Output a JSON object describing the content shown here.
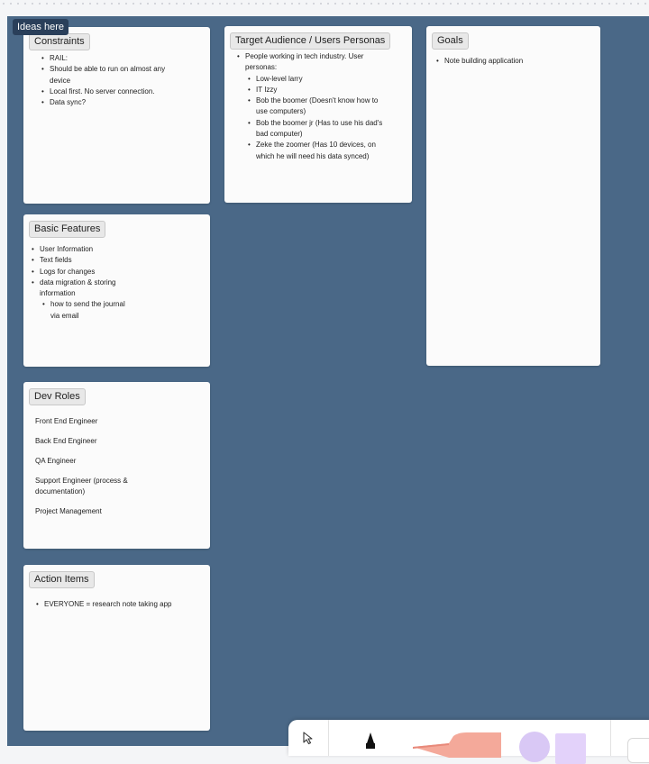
{
  "section": {
    "label": "Ideas here"
  },
  "cards": {
    "constraints": {
      "title": "Constraints",
      "items": [
        "RAIL:",
        "Should be able to run on almost any device",
        "Local first. No server connection.",
        "Data sync?"
      ]
    },
    "audience": {
      "title": "Target Audience / Users Personas",
      "intro": "People working in tech industry. User personas:",
      "personas": [
        "Low-level larry",
        "IT Izzy",
        "Bob the boomer (Doesn't know how to use computers)",
        "Bob the boomer jr (Has to use his dad's bad computer)",
        "Zeke the zoomer (Has 10 devices, on which he will need his data synced)"
      ]
    },
    "goals": {
      "title": "Goals",
      "items": [
        "Note building application"
      ]
    },
    "features": {
      "title": "Basic Features",
      "items": [
        "User Information",
        "Text fields",
        "Logs for changes",
        "data migration & storing information"
      ],
      "subitems": [
        "how to send the journal via email"
      ]
    },
    "roles": {
      "title": "Dev Roles",
      "items": [
        "Front End Engineer",
        "Back End Engineer",
        "QA Engineer",
        "Support Engineer (process & documentation)",
        "Project Management"
      ]
    },
    "actions": {
      "title": "Action Items",
      "items": [
        "EVERYONE = research note taking app"
      ]
    }
  },
  "toolbar": {
    "tools": [
      "cursor-icon",
      "marker-icon",
      "highlighter-icon",
      "circle-shape-icon",
      "square-shape-icon"
    ],
    "colors": {
      "marker": "#111111",
      "highlighter": "#f4a99a",
      "circle": "#d9c8f5",
      "square": "#e3d2fa"
    }
  }
}
